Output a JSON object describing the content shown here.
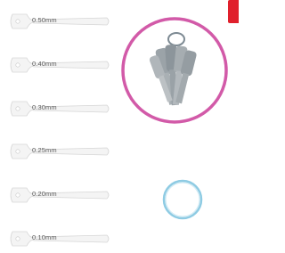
{
  "gauges": [
    {
      "label": "0.50mm"
    },
    {
      "label": "0.40mm"
    },
    {
      "label": "0.30mm"
    },
    {
      "label": "0.25mm"
    },
    {
      "label": "0.20mm"
    },
    {
      "label": "0.10mm"
    }
  ],
  "colors": {
    "badge": "#e0202c",
    "circle_border": "#d25aa8",
    "ring": "#8ecbe3"
  },
  "icons": {
    "keys_photo": "bundled-gauge-keys-on-ring",
    "ring": "split-key-ring"
  }
}
